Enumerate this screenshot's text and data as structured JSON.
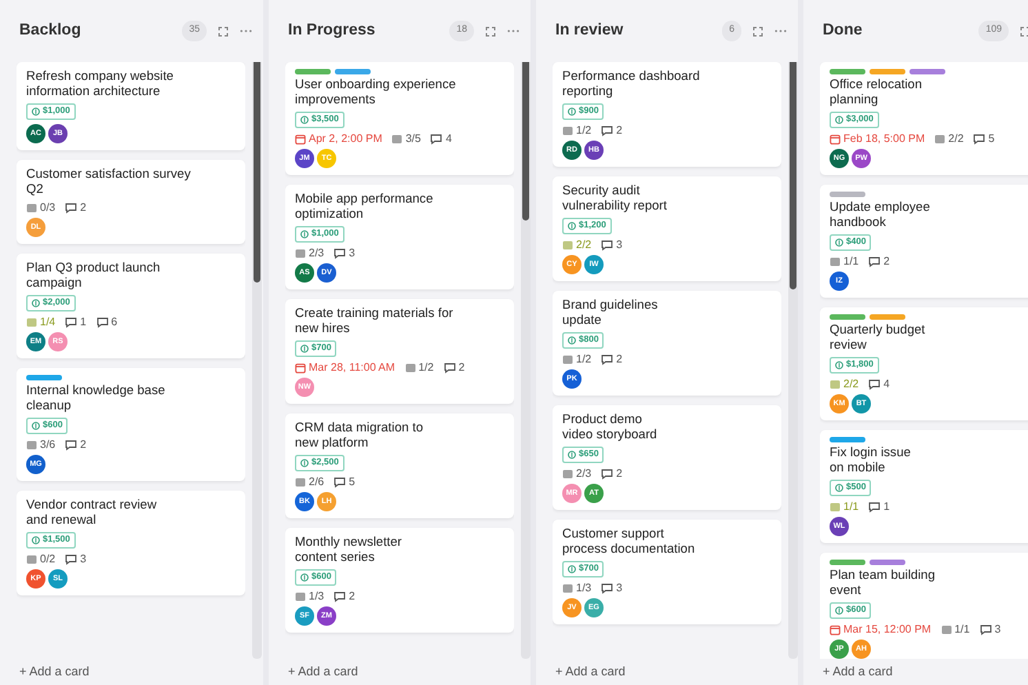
{
  "columns": [
    {
      "title": "Backlog",
      "count": "35",
      "cards": [
        {
          "title": "Refresh company website\ninformation architecture",
          "budget": "$1,000",
          "avatars": [
            {
              "initials": "AC",
              "color": "#0b6b4f"
            },
            {
              "initials": "JB",
              "color": "#6b3fb0"
            }
          ]
        },
        {
          "title": "Customer satisfaction survey\nQ2",
          "meta": [
            {
              "kind": "checklist",
              "text": "0/3",
              "highlighted": false
            },
            {
              "kind": "comment",
              "text": "2"
            }
          ],
          "avatars": [
            {
              "initials": "DL",
              "color": "#f59e3b"
            }
          ]
        },
        {
          "title": "Plan Q3 product launch\ncampaign",
          "budget": "$2,000",
          "meta": [
            {
              "kind": "checklist",
              "text": "1/4",
              "highlighted": true
            },
            {
              "kind": "comment",
              "text": "1"
            },
            {
              "kind": "comment",
              "text": "6"
            }
          ],
          "avatars": [
            {
              "initials": "EM",
              "color": "#0e7f86"
            },
            {
              "initials": "RS",
              "color": "#f48fb1"
            }
          ]
        },
        {
          "labels": [
            {
              "color": "#1ea7e8"
            }
          ],
          "title": "Internal knowledge base\ncleanup",
          "budget": "$600",
          "meta": [
            {
              "kind": "checklist",
              "text": "3/6",
              "highlighted": false
            },
            {
              "kind": "comment",
              "text": "2"
            }
          ],
          "avatars": [
            {
              "initials": "MG",
              "color": "#1260cc"
            }
          ]
        },
        {
          "title": "Vendor contract review\nand renewal",
          "budget": "$1,500",
          "meta": [
            {
              "kind": "checklist",
              "text": "0/2",
              "highlighted": false
            },
            {
              "kind": "comment",
              "text": "3"
            }
          ],
          "avatars": [
            {
              "initials": "KP",
              "color": "#f0522f"
            },
            {
              "initials": "SL",
              "color": "#149cbf"
            }
          ]
        }
      ],
      "add": "+ Add a card"
    },
    {
      "title": "In Progress",
      "count": "18",
      "cards": [
        {
          "labels": [
            {
              "color": "#5bb85d"
            },
            {
              "color": "#3aa8e8"
            }
          ],
          "title": "User onboarding experience\nimprovements",
          "budget": "$3,500",
          "meta": [
            {
              "kind": "due",
              "text": "Apr 2, 2:00 PM"
            },
            {
              "kind": "checklist",
              "text": "3/5",
              "highlighted": false
            },
            {
              "kind": "comment",
              "text": "4"
            }
          ],
          "avatars": [
            {
              "initials": "JM",
              "color": "#5b44c7"
            },
            {
              "initials": "TC",
              "color": "#f7c600"
            }
          ]
        },
        {
          "title": "Mobile app performance\noptimization",
          "budget": "$1,000",
          "meta": [
            {
              "kind": "checklist",
              "text": "2/3",
              "highlighted": false
            },
            {
              "kind": "comment",
              "text": "3"
            }
          ],
          "avatars": [
            {
              "initials": "AS",
              "color": "#137a48"
            },
            {
              "initials": "DV",
              "color": "#1a5fd1"
            }
          ]
        },
        {
          "title": "Create training materials for\nnew hires",
          "budget": "$700",
          "meta": [
            {
              "kind": "due",
              "text": "Mar 28, 11:00 AM"
            },
            {
              "kind": "checklist",
              "text": "1/2",
              "highlighted": false
            },
            {
              "kind": "comment",
              "text": "2"
            }
          ],
          "avatars": [
            {
              "initials": "NW",
              "color": "#f48fb1"
            }
          ]
        },
        {
          "title": "CRM data migration to\nnew platform",
          "budget": "$2,500",
          "meta": [
            {
              "kind": "checklist",
              "text": "2/6",
              "highlighted": false
            },
            {
              "kind": "comment",
              "text": "5"
            }
          ],
          "avatars": [
            {
              "initials": "BK",
              "color": "#1565d8"
            },
            {
              "initials": "LH",
              "color": "#f5a030"
            }
          ]
        },
        {
          "title": "Monthly newsletter\ncontent series",
          "budget": "$600",
          "meta": [
            {
              "kind": "checklist",
              "text": "1/3",
              "highlighted": false
            },
            {
              "kind": "comment",
              "text": "2"
            }
          ],
          "avatars": [
            {
              "initials": "SF",
              "color": "#1a9cc0"
            },
            {
              "initials": "ZM",
              "color": "#8a3fc7"
            }
          ]
        }
      ],
      "add": "+ Add a card"
    },
    {
      "title": "In review",
      "count": "6",
      "cards": [
        {
          "title": "Performance dashboard\nreporting",
          "budget": "$900",
          "meta": [
            {
              "kind": "checklist",
              "text": "1/2",
              "highlighted": false
            },
            {
              "kind": "comment",
              "text": "2"
            }
          ],
          "avatars": [
            {
              "initials": "RD",
              "color": "#0d6b4f"
            },
            {
              "initials": "HB",
              "color": "#6a3fb6"
            }
          ]
        },
        {
          "title": "Security audit\nvulnerability report",
          "budget": "$1,200",
          "meta": [
            {
              "kind": "checklist",
              "text": "2/2",
              "highlighted": true
            },
            {
              "kind": "comment",
              "text": "3"
            }
          ],
          "avatars": [
            {
              "initials": "CY",
              "color": "#f79421"
            },
            {
              "initials": "IW",
              "color": "#149bbd"
            }
          ]
        },
        {
          "title": "Brand guidelines\nupdate",
          "budget": "$800",
          "meta": [
            {
              "kind": "checklist",
              "text": "1/2",
              "highlighted": false
            },
            {
              "kind": "comment",
              "text": "2"
            }
          ],
          "avatars": [
            {
              "initials": "PK",
              "color": "#1560d6"
            }
          ]
        },
        {
          "title": "Product demo\nvideo storyboard",
          "budget": "$650",
          "meta": [
            {
              "kind": "checklist",
              "text": "2/3",
              "highlighted": false
            },
            {
              "kind": "comment",
              "text": "2"
            }
          ],
          "avatars": [
            {
              "initials": "MR",
              "color": "#f48fb1"
            },
            {
              "initials": "AT",
              "color": "#3aa04a"
            }
          ]
        },
        {
          "title": "Customer support\nprocess documentation",
          "budget": "$700",
          "meta": [
            {
              "kind": "checklist",
              "text": "1/3",
              "highlighted": false
            },
            {
              "kind": "comment",
              "text": "3"
            }
          ],
          "avatars": [
            {
              "initials": "JV",
              "color": "#f79421"
            },
            {
              "initials": "EG",
              "color": "#3aaea8"
            }
          ]
        }
      ],
      "add": "+ Add a card"
    },
    {
      "title": "Done",
      "count": "109",
      "cards": [
        {
          "labels": [
            {
              "color": "#5bb85d"
            },
            {
              "color": "#f5a623"
            },
            {
              "color": "#a77fdc"
            }
          ],
          "title": "Office relocation\nplanning",
          "budget": "$3,000",
          "meta": [
            {
              "kind": "due",
              "text": "Feb 18, 5:00 PM"
            },
            {
              "kind": "checklist",
              "text": "2/2",
              "highlighted": false
            },
            {
              "kind": "comment",
              "text": "5"
            }
          ],
          "avatars": [
            {
              "initials": "NG",
              "color": "#0d6b4f"
            },
            {
              "initials": "PW",
              "color": "#9b48c7"
            }
          ]
        },
        {
          "labels": [
            {
              "color": "#b8b8c0"
            }
          ],
          "title": "Update employee\nhandbook",
          "budget": "$400",
          "meta": [
            {
              "kind": "checklist",
              "text": "1/1",
              "highlighted": false
            },
            {
              "kind": "comment",
              "text": "2"
            }
          ],
          "avatars": [
            {
              "initials": "IZ",
              "color": "#1560d6"
            }
          ]
        },
        {
          "labels": [
            {
              "color": "#5bb85d"
            },
            {
              "color": "#f5a623"
            }
          ],
          "title": "Quarterly budget\nreview",
          "budget": "$1,800",
          "meta": [
            {
              "kind": "checklist",
              "text": "2/2",
              "highlighted": true
            },
            {
              "kind": "comment",
              "text": "4"
            }
          ],
          "avatars": [
            {
              "initials": "KM",
              "color": "#f79421"
            },
            {
              "initials": "BT",
              "color": "#1296a8"
            }
          ]
        },
        {
          "labels": [
            {
              "color": "#1ea7e8"
            }
          ],
          "title": "Fix login issue\non mobile",
          "budget": "$500",
          "meta": [
            {
              "kind": "checklist",
              "text": "1/1",
              "highlighted": true
            },
            {
              "kind": "comment",
              "text": "1"
            }
          ],
          "avatars": [
            {
              "initials": "WL",
              "color": "#6a3fb6"
            }
          ]
        },
        {
          "labels": [
            {
              "color": "#5bb85d"
            },
            {
              "color": "#a77fdc"
            }
          ],
          "title": "Plan team building\nevent",
          "budget": "$600",
          "meta": [
            {
              "kind": "due",
              "text": "Mar 15, 12:00 PM"
            },
            {
              "kind": "checklist",
              "text": "1/1",
              "highlighted": false
            },
            {
              "kind": "comment",
              "text": "3"
            }
          ],
          "avatars": [
            {
              "initials": "JP",
              "color": "#3aa04a"
            },
            {
              "initials": "AH",
              "color": "#f79421"
            }
          ]
        }
      ],
      "add": "+ Add a card"
    }
  ]
}
